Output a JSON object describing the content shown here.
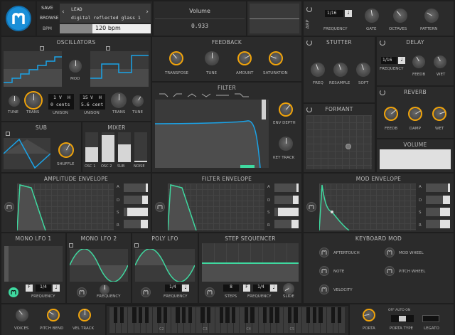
{
  "header": {
    "save": "SAVE",
    "browse": "BROWSE",
    "bpm_label": "BPM",
    "bpm_value": "120 bpm",
    "category": "LEAD",
    "preset": "digital reflected glass 1",
    "param_name": "Volume",
    "param_value": "0.933"
  },
  "arp": {
    "label": "ARP",
    "division": "1/16",
    "frequency": "FREQUENCY",
    "gate": "GATE",
    "octaves": "OCTAVES",
    "pattern": "PATTERN"
  },
  "oscillators": {
    "title": "OSCILLATORS",
    "mod": "MOD",
    "osc1_tune_label": "TUNE",
    "osc1_trans_label": "TRANS",
    "osc1_voices": "1",
    "osc1_v": "V",
    "osc1_h": "H",
    "osc1_cents": "0 cents",
    "unison1": "UNISON",
    "osc2_voices": "15",
    "osc2_v": "V",
    "osc2_h": "H",
    "osc2_cents": "5.6 cent",
    "unison2": "UNISON",
    "osc2_trans_label": "TRANS",
    "osc2_tune_label": "TUNE"
  },
  "feedback": {
    "title": "FEEDBACK",
    "transpose": "TRANSPOSE",
    "tune": "TUNE",
    "amount": "AMOUNT",
    "saturation": "SATURATION"
  },
  "stutter": {
    "title": "STUTTER",
    "freq": "FREQ",
    "resample": "RESAMPLE",
    "soft": "SOFT"
  },
  "delay": {
    "title": "DELAY",
    "division": "1/16",
    "frequency": "FREQUENCY",
    "feedb": "FEEDB",
    "wet": "WET"
  },
  "sub": {
    "title": "SUB",
    "shuffle": "SHUFFLE"
  },
  "mixer": {
    "title": "MIXER",
    "channels": [
      "OSC 1",
      "OSC 2",
      "SUB",
      "NOISE"
    ],
    "levels": [
      0.5,
      0.9,
      0.6,
      0.05
    ]
  },
  "filter": {
    "title": "FILTER",
    "env_depth": "ENV DEPTH",
    "key_track": "KEY TRACK"
  },
  "formant": {
    "title": "FORMANT"
  },
  "reverb": {
    "title": "REVERB",
    "feedb": "FEEDB",
    "damp": "DAMP",
    "wet": "WET"
  },
  "volume": {
    "title": "VOLUME",
    "level": 0.9
  },
  "envelopes": {
    "amp": {
      "title": "AMPLITUDE ENVELOPE",
      "a": 0.1,
      "d": 0.25,
      "s": 0.85,
      "r": 0.3
    },
    "filter": {
      "title": "FILTER ENVELOPE",
      "a": 0.1,
      "d": 0.25,
      "s": 0.85,
      "r": 0.3
    },
    "mod": {
      "title": "MOD ENVELOPE",
      "a": 0.1,
      "d": 0.3,
      "s": 0.4,
      "r": 0.4
    },
    "letters": [
      "A",
      "D",
      "S",
      "R"
    ]
  },
  "lfos": {
    "mono1": {
      "title": "MONO LFO 1",
      "f": "F",
      "division": "1/4",
      "frequency": "FREQUENCY"
    },
    "mono2": {
      "title": "MONO LFO 2",
      "frequency": "FREQUENCY"
    },
    "poly": {
      "title": "POLY LFO",
      "division": "1/4",
      "frequency": "FREQUENCY"
    }
  },
  "step_sequencer": {
    "title": "STEP SEQUENCER",
    "steps_value": "8",
    "steps": "STEPS",
    "f": "F",
    "division": "1/4",
    "frequency": "FREQUENCY",
    "slide": "SLIDE"
  },
  "keyboard_mod": {
    "title": "KEYBOARD MOD",
    "aftertouch": "AFTERTOUCH",
    "mod_wheel": "MOD WHEEL",
    "note": "NOTE",
    "pitch_wheel": "PITCH WHEEL",
    "velocity": "VELOCITY"
  },
  "footer": {
    "voices": "VOICES",
    "pitch_bend": "PITCH BEND",
    "vel_track": "VEL TRACK",
    "octave_labels": [
      "C2",
      "C3",
      "C4",
      "C5"
    ],
    "porta": "PORTA",
    "porta_type": "PORTA TYPE",
    "porta_opts": "OFF AUTO ON",
    "legato": "LEGATO"
  },
  "colors": {
    "accent": "#f0a30a",
    "green": "#3fd9a0",
    "blue": "#1aa3e8",
    "panel": "#2b2b2b"
  }
}
